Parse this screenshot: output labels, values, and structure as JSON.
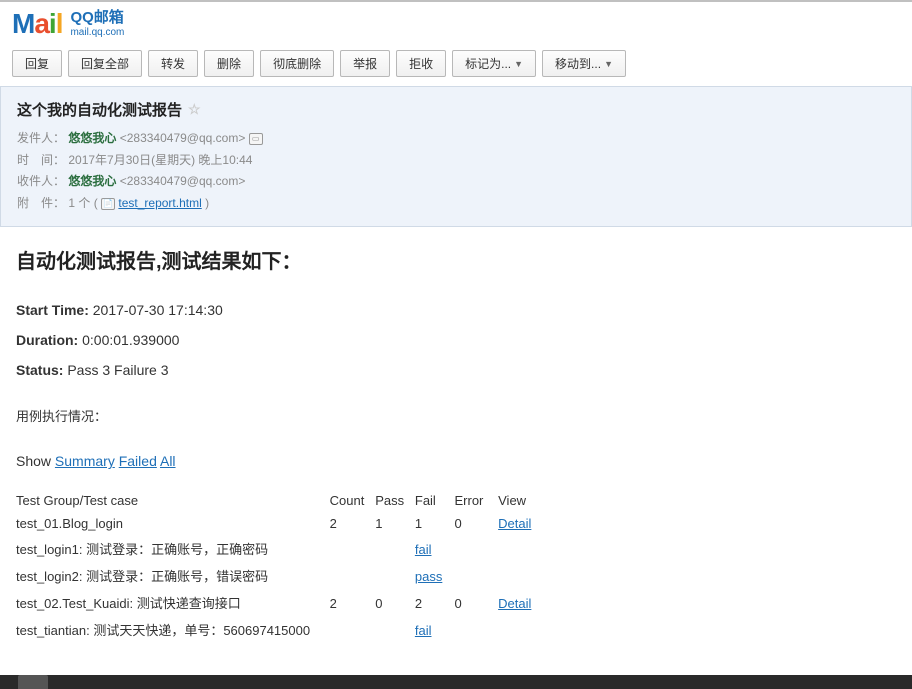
{
  "logo": {
    "qq": "QQ邮箱",
    "url": "mail.qq.com"
  },
  "toolbar": {
    "reply": "回复",
    "reply_all": "回复全部",
    "forward": "转发",
    "delete": "删除",
    "delete_perm": "彻底删除",
    "report": "举报",
    "reject": "拒收",
    "mark_as": "标记为...",
    "move_to": "移动到..."
  },
  "mail": {
    "subject": "这个我的自动化测试报告",
    "from_label": "发件人：",
    "from_name": "悠悠我心",
    "from_email": "<283340479@qq.com>",
    "time_label": "时　间：",
    "time_value": "2017年7月30日(星期天) 晚上10:44",
    "to_label": "收件人：",
    "to_name": "悠悠我心",
    "to_email": "<283340479@qq.com>",
    "attach_label": "附　件：",
    "attach_count": "1 个 (",
    "attach_name": "test_report.html",
    "attach_close": ")"
  },
  "report": {
    "title": "自动化测试报告,测试结果如下：",
    "start_label": "Start Time:",
    "start_value": "2017-07-30 17:14:30",
    "duration_label": "Duration:",
    "duration_value": "0:00:01.939000",
    "status_label": "Status:",
    "status_value": "Pass 3 Failure 3",
    "cases_label": "用例执行情况：",
    "show_label": "Show",
    "link_summary": "Summary",
    "link_failed": "Failed",
    "link_all": "All"
  },
  "table": {
    "headers": {
      "group": "Test Group/Test case",
      "count": "Count",
      "pass": "Pass",
      "fail": "Fail",
      "error": "Error",
      "view": "View"
    },
    "rows": [
      {
        "group": "test_01.Blog_login",
        "count": "2",
        "pass": "1",
        "fail": "1",
        "error": "0",
        "view": "Detail",
        "view_is_link": true
      },
      {
        "group": "test_login1: 测试登录：正确账号，正确密码",
        "count": "",
        "pass": "",
        "fail": "fail",
        "error": "",
        "view": "",
        "fail_is_link": true
      },
      {
        "group": "test_login2: 测试登录：正确账号，错误密码",
        "count": "",
        "pass": "",
        "fail": "pass",
        "error": "",
        "view": "",
        "fail_is_link": true
      },
      {
        "group": "test_02.Test_Kuaidi: 测试快递查询接口",
        "count": "2",
        "pass": "0",
        "fail": "2",
        "error": "0",
        "view": "Detail",
        "view_is_link": true
      },
      {
        "group": "test_tiantian: 测试天天快递，单号：560697415000",
        "count": "",
        "pass": "",
        "fail": "fail",
        "error": "",
        "view": "",
        "fail_is_link": true
      }
    ]
  }
}
